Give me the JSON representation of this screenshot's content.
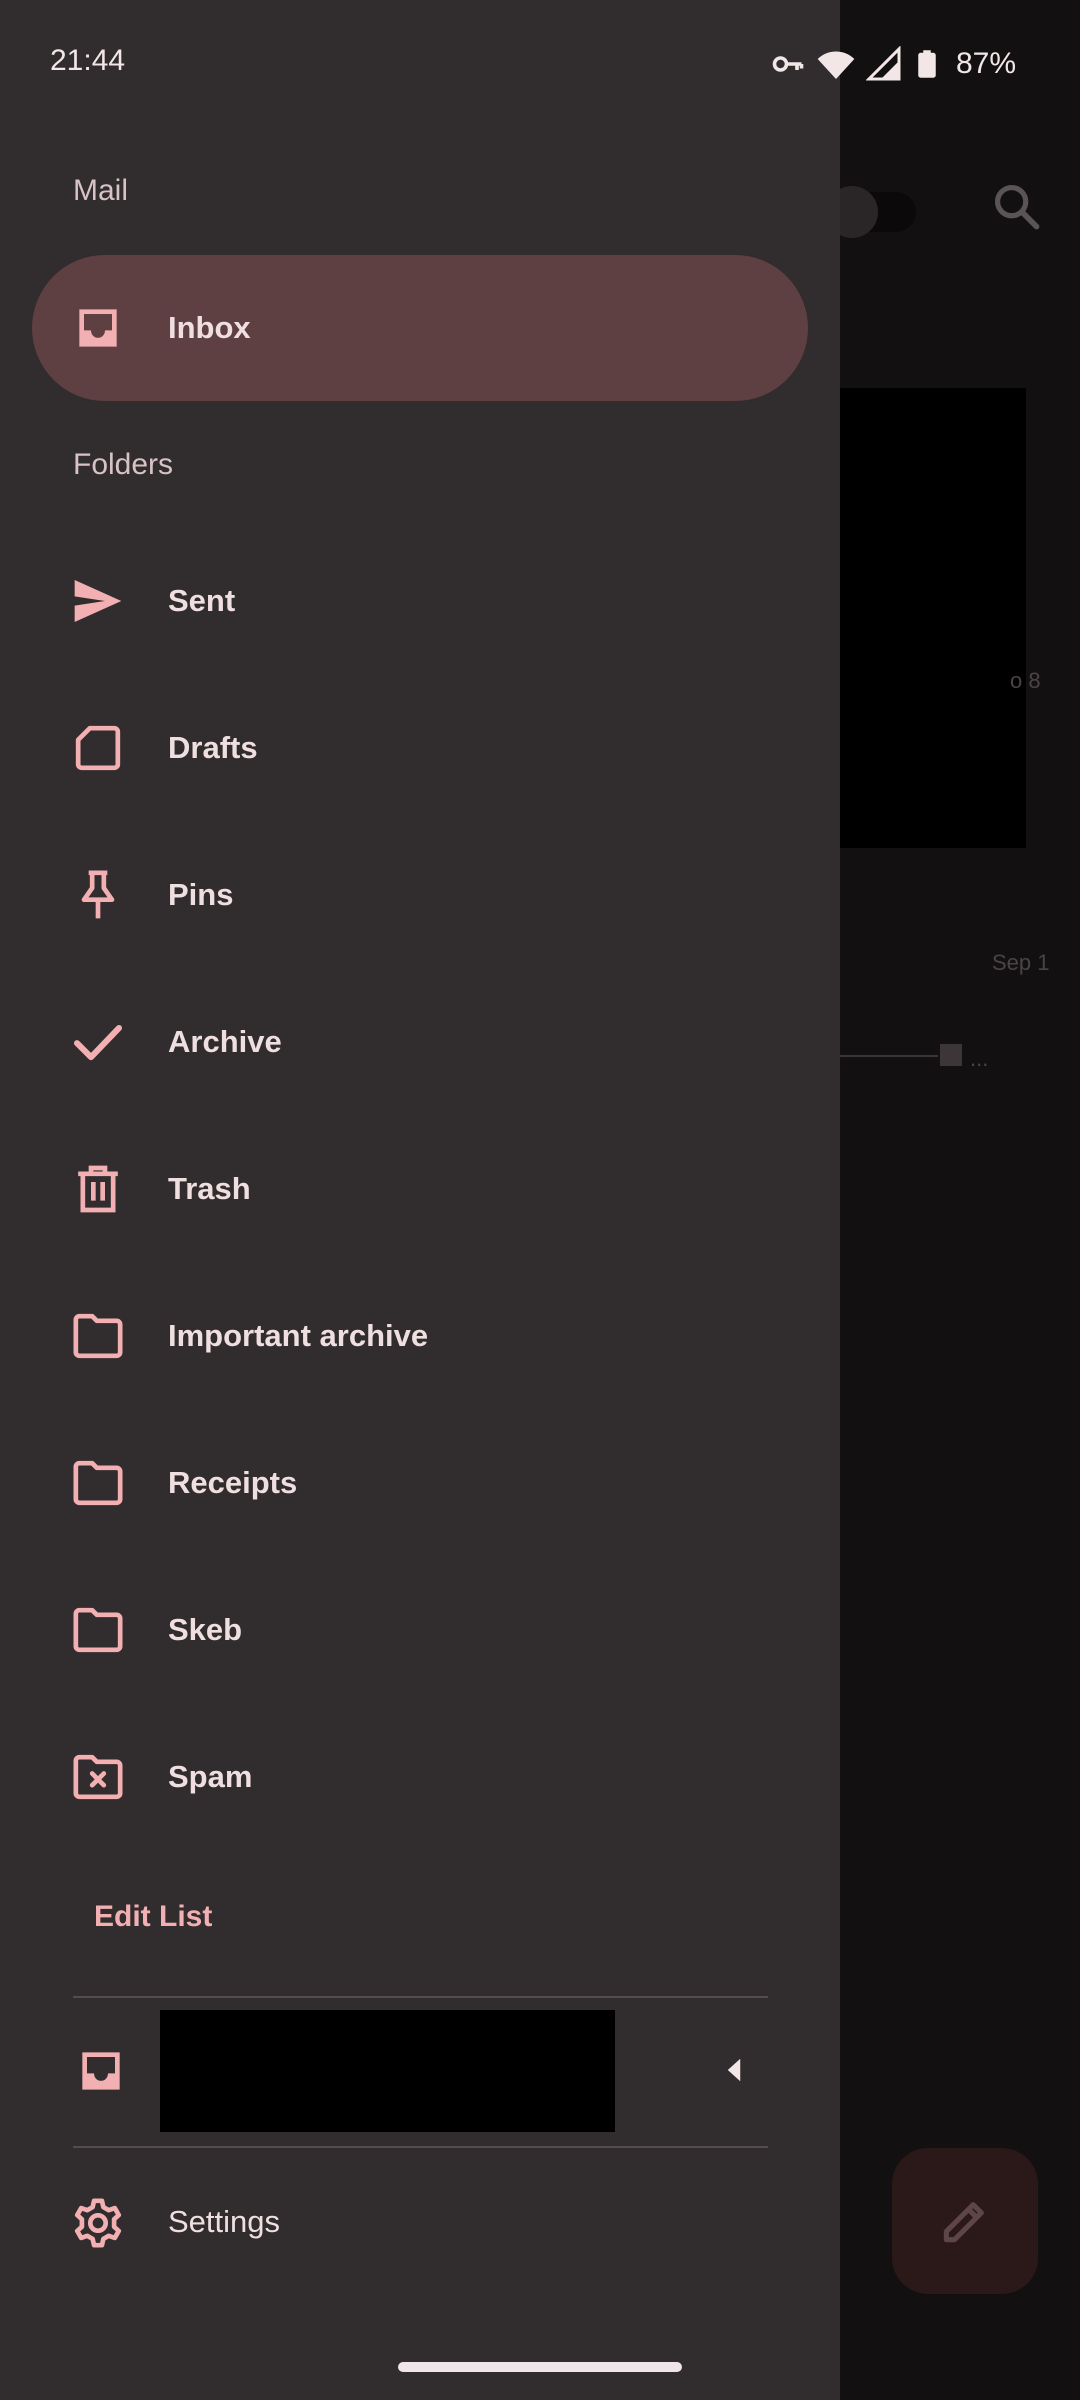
{
  "status_bar": {
    "time": "21:44",
    "battery": "87%"
  },
  "drawer": {
    "mail_label": "Mail",
    "inbox_label": "Inbox",
    "folders_label": "Folders",
    "folders": [
      {
        "label": "Sent",
        "icon": "send-icon"
      },
      {
        "label": "Drafts",
        "icon": "draft-icon"
      },
      {
        "label": "Pins",
        "icon": "pin-icon"
      },
      {
        "label": "Archive",
        "icon": "check-icon"
      },
      {
        "label": "Trash",
        "icon": "trash-icon"
      },
      {
        "label": "Important archive",
        "icon": "folder-icon"
      },
      {
        "label": "Receipts",
        "icon": "folder-icon"
      },
      {
        "label": "Skeb",
        "icon": "folder-icon"
      },
      {
        "label": "Spam",
        "icon": "spam-folder-icon"
      }
    ],
    "edit_list_label": "Edit List",
    "settings_label": "Settings"
  },
  "background": {
    "dates": [
      "o 8",
      "Sep 1"
    ]
  },
  "colors": {
    "drawer_bg": "#312c2d",
    "accent": "#f3b0b3",
    "active_item": "#5f4042"
  }
}
